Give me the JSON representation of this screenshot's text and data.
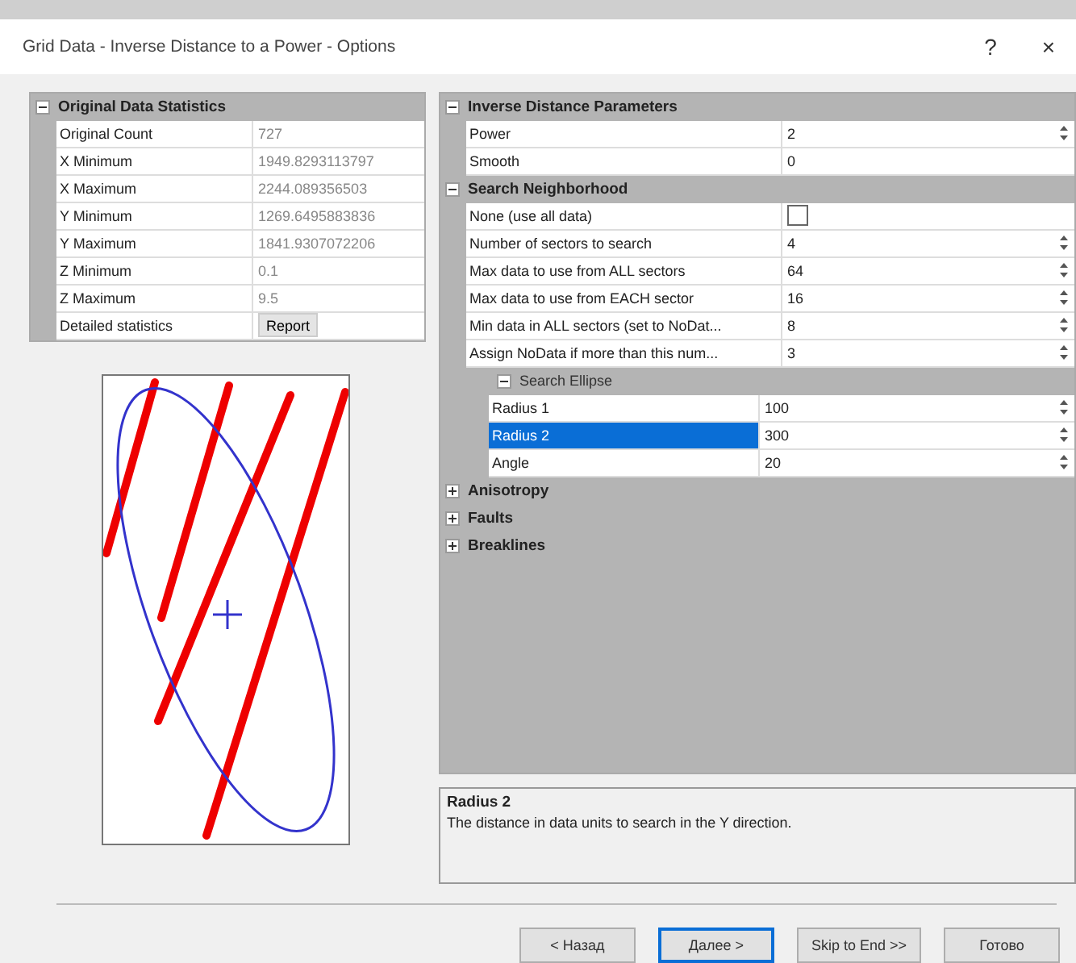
{
  "window": {
    "title": "Grid Data - Inverse Distance to a Power - Options",
    "help": "?",
    "close": "×"
  },
  "statistics": {
    "title": "Original Data Statistics",
    "expanded": true,
    "rows": [
      {
        "label": "Original Count",
        "value": "727",
        "kind": "text"
      },
      {
        "label": "X Minimum",
        "value": "1949.8293113797",
        "kind": "text"
      },
      {
        "label": "X Maximum",
        "value": "2244.089356503",
        "kind": "text"
      },
      {
        "label": "Y Minimum",
        "value": "1269.6495883836",
        "kind": "text"
      },
      {
        "label": "Y Maximum",
        "value": "1841.9307072206",
        "kind": "text"
      },
      {
        "label": "Z Minimum",
        "value": "0.1",
        "kind": "text"
      },
      {
        "label": "Z Maximum",
        "value": "9.5",
        "kind": "text"
      },
      {
        "label": "Detailed statistics",
        "value": "Report",
        "kind": "button"
      }
    ]
  },
  "parameters": [
    {
      "title": "Inverse Distance Parameters",
      "expanded": true,
      "items": [
        {
          "kind": "spin",
          "label": "Power",
          "value": "2",
          "selected": false
        },
        {
          "kind": "text",
          "label": "Smooth",
          "value": "0",
          "selected": false
        }
      ]
    },
    {
      "title": "Search Neighborhood",
      "expanded": true,
      "items": [
        {
          "kind": "checkbox",
          "label": "None (use all data)",
          "checked": false,
          "selected": false
        },
        {
          "kind": "spin",
          "label": "Number of sectors to search",
          "value": "4",
          "selected": false
        },
        {
          "kind": "spin",
          "label": "Max data to use from ALL sectors",
          "value": "64",
          "selected": false
        },
        {
          "kind": "spin",
          "label": "Max data to use from EACH sector",
          "value": "16",
          "selected": false
        },
        {
          "kind": "spin",
          "label": "Min data in ALL sectors (set to NoDat...",
          "value": "8",
          "selected": false
        },
        {
          "kind": "spin",
          "label": "Assign NoData if more than this num...",
          "value": "3",
          "selected": false
        },
        {
          "kind": "group",
          "label": "Search Ellipse",
          "expanded": true,
          "children": [
            {
              "kind": "spin",
              "label": "Radius 1",
              "value": "100",
              "selected": false
            },
            {
              "kind": "spin",
              "label": "Radius 2",
              "value": "300",
              "selected": true
            },
            {
              "kind": "spin",
              "label": "Angle",
              "value": "20",
              "selected": false
            }
          ]
        }
      ]
    },
    {
      "title": "Anisotropy",
      "expanded": false
    },
    {
      "title": "Faults",
      "expanded": false
    },
    {
      "title": "Breaklines",
      "expanded": false
    }
  ],
  "description": {
    "title": "Radius 2",
    "text": "The distance in data units to search in the Y direction."
  },
  "buttons": [
    {
      "label": "< Назад",
      "default": false
    },
    {
      "label": "Далее >",
      "default": true
    },
    {
      "label": "Skip to End >>",
      "default": false
    },
    {
      "label": "Готово",
      "default": false
    }
  ]
}
